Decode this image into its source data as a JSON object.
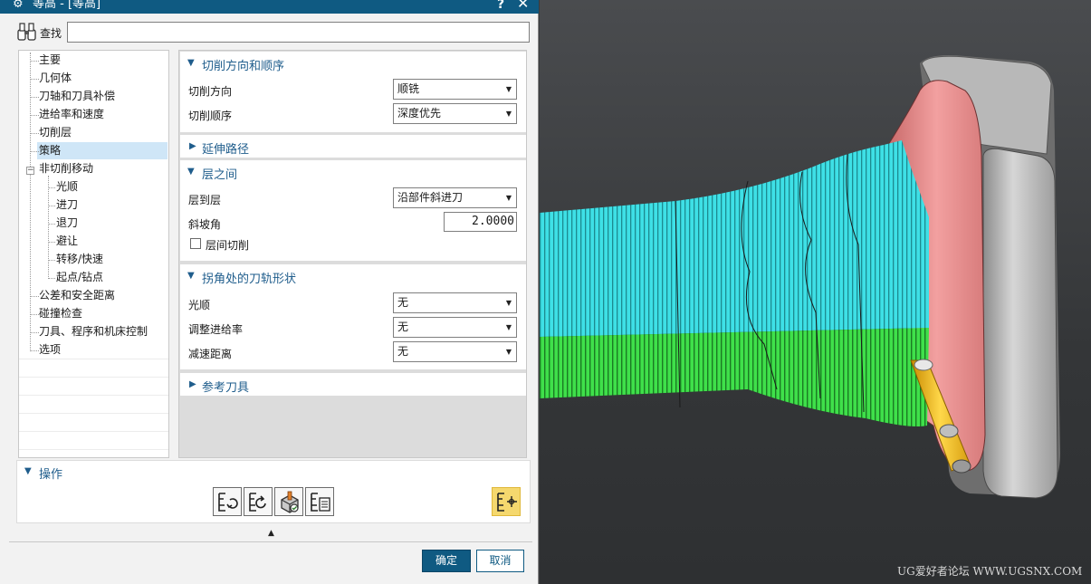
{
  "window": {
    "title": "等高 - [等高]",
    "help_glyph": "?",
    "close_glyph": "✕",
    "gear_glyph": "⚙"
  },
  "search": {
    "label": "查找",
    "value": ""
  },
  "nav": {
    "items": [
      {
        "label": "主要"
      },
      {
        "label": "几何体"
      },
      {
        "label": "刀轴和刀具补偿"
      },
      {
        "label": "进给率和速度"
      },
      {
        "label": "切削层"
      },
      {
        "label": "策略",
        "selected": true
      },
      {
        "label": "非切削移动",
        "expander": "−"
      },
      {
        "label": "光顺"
      },
      {
        "label": "进刀"
      },
      {
        "label": "退刀"
      },
      {
        "label": "避让"
      },
      {
        "label": "转移/快速"
      },
      {
        "label": "起点/钻点"
      },
      {
        "label": "公差和安全距离"
      },
      {
        "label": "碰撞检查"
      },
      {
        "label": "刀具、程序和机床控制"
      },
      {
        "label": "选项"
      }
    ]
  },
  "sections": {
    "cut_dir": {
      "title": "切削方向和顺序",
      "expanded": true,
      "fields": [
        {
          "label": "切削方向",
          "value": "顺铣"
        },
        {
          "label": "切削顺序",
          "value": "深度优先"
        }
      ]
    },
    "extend": {
      "title": "延伸路径",
      "expanded": false
    },
    "between_levels": {
      "title": "层之间",
      "expanded": true,
      "level_to_level": {
        "label": "层到层",
        "value": "沿部件斜进刀"
      },
      "ramp_angle": {
        "label": "斜坡角",
        "value": "2.0000"
      },
      "inter_level_cut": {
        "label": "层间切削",
        "checked": false
      }
    },
    "corner": {
      "title": "拐角处的刀轨形状",
      "expanded": true,
      "fields": [
        {
          "label": "光顺",
          "value": "无"
        },
        {
          "label": "调整进给率",
          "value": "无"
        },
        {
          "label": "减速距离",
          "value": "无"
        }
      ]
    },
    "ref_tool": {
      "title": "参考刀具",
      "expanded": false
    }
  },
  "operations": {
    "title": "操作",
    "buttons": [
      "generate-icon",
      "replay-icon",
      "verify-icon",
      "list-icon",
      "edit-display-icon"
    ]
  },
  "buttons": {
    "ok": "确定",
    "cancel": "取消"
  },
  "viewport": {
    "watermark": "UG爱好者论坛 WWW.UGSNX.COM"
  },
  "colors": {
    "accent": "#0f5a82",
    "toolpath_cyan": "#3ee0e6",
    "toolpath_green": "#3fe04a",
    "part_pink": "#e98b8b",
    "tool_yellow": "#f0c020"
  }
}
